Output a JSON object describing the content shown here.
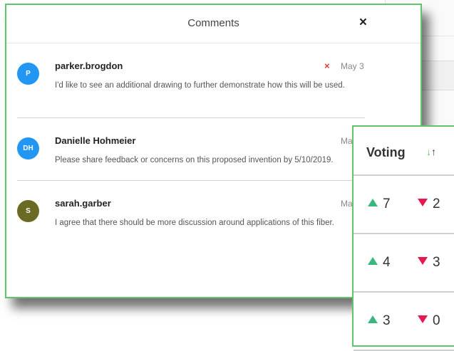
{
  "modal": {
    "title": "Comments",
    "close_glyph": "×"
  },
  "comments": [
    {
      "initials": "P",
      "avatar_color": "#2196f3",
      "author": "parker.brogdon",
      "date": "May 3",
      "delete_glyph": "×",
      "text": "I'd like to see an additional drawing to further demonstrate how this will be used."
    },
    {
      "initials": "DH",
      "avatar_color": "#2196f3",
      "author": "Danielle Hohmeier",
      "date": "May",
      "text": "Please share feedback or concerns on this proposed invention by 5/10/2019."
    },
    {
      "initials": "S",
      "avatar_color": "#6b6a24",
      "author": "sarah.garber",
      "date": "May",
      "text": "I agree that there should be more discussion around applications of this fiber."
    }
  ],
  "voting": {
    "title": "Voting",
    "sort_down_glyph": "↓",
    "sort_up_glyph": "↑",
    "colors": {
      "up": "#39b77e",
      "down": "#e8174f"
    },
    "rows": [
      {
        "up": "7",
        "down": "2"
      },
      {
        "up": "4",
        "down": "3"
      },
      {
        "up": "3",
        "down": "0"
      }
    ]
  }
}
